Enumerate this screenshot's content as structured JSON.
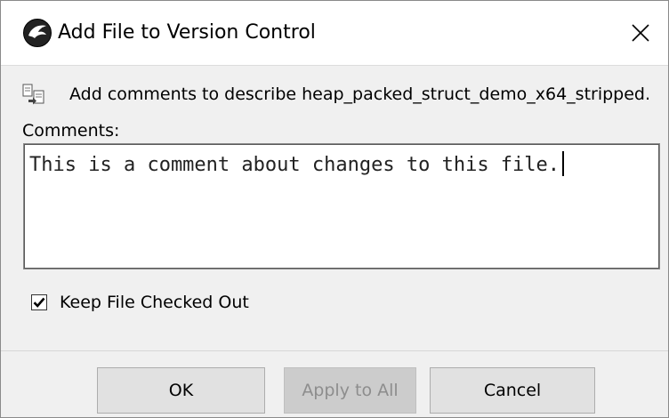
{
  "window": {
    "title": "Add File to Version Control",
    "close_glyph": "✕"
  },
  "info": {
    "icon": "add-file-icon",
    "message": "Add comments to describe heap_packed_struct_demo_x64_stripped."
  },
  "comments": {
    "label": "Comments:",
    "value": "This is a comment about changes to this file."
  },
  "options": {
    "keep_checked_out_label": "Keep File Checked Out",
    "keep_checked_out": true
  },
  "buttons": {
    "ok": "OK",
    "apply_all": "Apply to All",
    "cancel": "Cancel"
  },
  "colors": {
    "window_bg": "#f0f0f0",
    "titlebar_bg": "#ffffff",
    "button_bg": "#e1e1e1",
    "disabled_text": "#8d8d8d"
  }
}
